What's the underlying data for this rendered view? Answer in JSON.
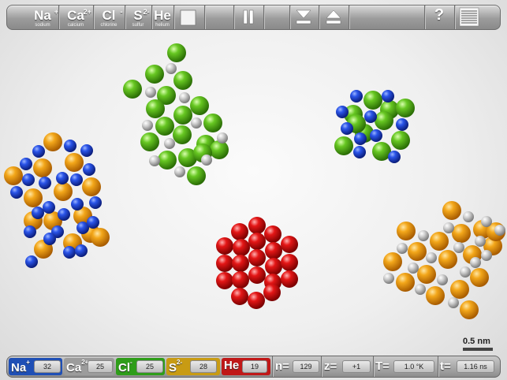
{
  "toolbar": {
    "elements": [
      {
        "symbol": "Na",
        "charge": "+",
        "name": "sodium"
      },
      {
        "symbol": "Ca",
        "charge": "2+",
        "name": "calcium"
      },
      {
        "symbol": "Cl",
        "charge": "-",
        "name": "chlorine"
      },
      {
        "symbol": "S",
        "charge": "2-",
        "name": "sulfur"
      },
      {
        "symbol": "He",
        "charge": "",
        "name": "helium"
      }
    ],
    "help_label": "?"
  },
  "colors": {
    "sodium": "#1c3fd6",
    "calcium": "#f0a013",
    "chlorine": "#5cc21c",
    "sulfur": "#cfa015",
    "helium": "#c8c8c8",
    "red": "#e01515"
  },
  "scale_bar": {
    "label": "0.5 nm"
  },
  "status": {
    "counts": [
      {
        "symbol": "Na",
        "charge": "+",
        "value": "32",
        "color": "#1f4fb5"
      },
      {
        "symbol": "Ca",
        "charge": "2+",
        "value": "25",
        "color": "#9a9a9a"
      },
      {
        "symbol": "Cl",
        "charge": "-",
        "value": "25",
        "color": "#2e9d19"
      },
      {
        "symbol": "S",
        "charge": "2-",
        "value": "28",
        "color": "#c89b13"
      },
      {
        "symbol": "He",
        "charge": "",
        "value": "19",
        "color": "#c01818"
      }
    ],
    "params": [
      {
        "label": "n=",
        "value": "129"
      },
      {
        "label": "z=",
        "value": "+1"
      },
      {
        "label": "T=",
        "value": "1.0 °K"
      },
      {
        "label": "t=",
        "value": "1.16  ns"
      }
    ]
  }
}
